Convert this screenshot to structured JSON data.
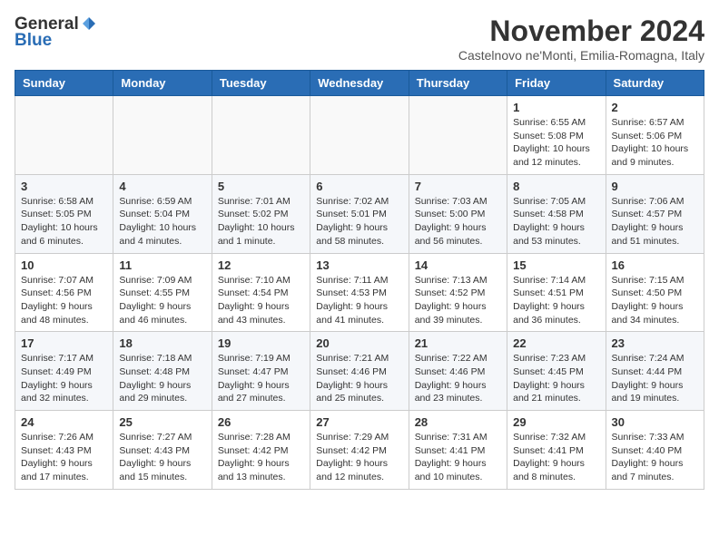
{
  "header": {
    "logo_general": "General",
    "logo_blue": "Blue",
    "month_title": "November 2024",
    "subtitle": "Castelnovo ne'Monti, Emilia-Romagna, Italy"
  },
  "weekdays": [
    "Sunday",
    "Monday",
    "Tuesday",
    "Wednesday",
    "Thursday",
    "Friday",
    "Saturday"
  ],
  "weeks": [
    [
      {
        "day": "",
        "info": ""
      },
      {
        "day": "",
        "info": ""
      },
      {
        "day": "",
        "info": ""
      },
      {
        "day": "",
        "info": ""
      },
      {
        "day": "",
        "info": ""
      },
      {
        "day": "1",
        "info": "Sunrise: 6:55 AM\nSunset: 5:08 PM\nDaylight: 10 hours and 12 minutes."
      },
      {
        "day": "2",
        "info": "Sunrise: 6:57 AM\nSunset: 5:06 PM\nDaylight: 10 hours and 9 minutes."
      }
    ],
    [
      {
        "day": "3",
        "info": "Sunrise: 6:58 AM\nSunset: 5:05 PM\nDaylight: 10 hours and 6 minutes."
      },
      {
        "day": "4",
        "info": "Sunrise: 6:59 AM\nSunset: 5:04 PM\nDaylight: 10 hours and 4 minutes."
      },
      {
        "day": "5",
        "info": "Sunrise: 7:01 AM\nSunset: 5:02 PM\nDaylight: 10 hours and 1 minute."
      },
      {
        "day": "6",
        "info": "Sunrise: 7:02 AM\nSunset: 5:01 PM\nDaylight: 9 hours and 58 minutes."
      },
      {
        "day": "7",
        "info": "Sunrise: 7:03 AM\nSunset: 5:00 PM\nDaylight: 9 hours and 56 minutes."
      },
      {
        "day": "8",
        "info": "Sunrise: 7:05 AM\nSunset: 4:58 PM\nDaylight: 9 hours and 53 minutes."
      },
      {
        "day": "9",
        "info": "Sunrise: 7:06 AM\nSunset: 4:57 PM\nDaylight: 9 hours and 51 minutes."
      }
    ],
    [
      {
        "day": "10",
        "info": "Sunrise: 7:07 AM\nSunset: 4:56 PM\nDaylight: 9 hours and 48 minutes."
      },
      {
        "day": "11",
        "info": "Sunrise: 7:09 AM\nSunset: 4:55 PM\nDaylight: 9 hours and 46 minutes."
      },
      {
        "day": "12",
        "info": "Sunrise: 7:10 AM\nSunset: 4:54 PM\nDaylight: 9 hours and 43 minutes."
      },
      {
        "day": "13",
        "info": "Sunrise: 7:11 AM\nSunset: 4:53 PM\nDaylight: 9 hours and 41 minutes."
      },
      {
        "day": "14",
        "info": "Sunrise: 7:13 AM\nSunset: 4:52 PM\nDaylight: 9 hours and 39 minutes."
      },
      {
        "day": "15",
        "info": "Sunrise: 7:14 AM\nSunset: 4:51 PM\nDaylight: 9 hours and 36 minutes."
      },
      {
        "day": "16",
        "info": "Sunrise: 7:15 AM\nSunset: 4:50 PM\nDaylight: 9 hours and 34 minutes."
      }
    ],
    [
      {
        "day": "17",
        "info": "Sunrise: 7:17 AM\nSunset: 4:49 PM\nDaylight: 9 hours and 32 minutes."
      },
      {
        "day": "18",
        "info": "Sunrise: 7:18 AM\nSunset: 4:48 PM\nDaylight: 9 hours and 29 minutes."
      },
      {
        "day": "19",
        "info": "Sunrise: 7:19 AM\nSunset: 4:47 PM\nDaylight: 9 hours and 27 minutes."
      },
      {
        "day": "20",
        "info": "Sunrise: 7:21 AM\nSunset: 4:46 PM\nDaylight: 9 hours and 25 minutes."
      },
      {
        "day": "21",
        "info": "Sunrise: 7:22 AM\nSunset: 4:46 PM\nDaylight: 9 hours and 23 minutes."
      },
      {
        "day": "22",
        "info": "Sunrise: 7:23 AM\nSunset: 4:45 PM\nDaylight: 9 hours and 21 minutes."
      },
      {
        "day": "23",
        "info": "Sunrise: 7:24 AM\nSunset: 4:44 PM\nDaylight: 9 hours and 19 minutes."
      }
    ],
    [
      {
        "day": "24",
        "info": "Sunrise: 7:26 AM\nSunset: 4:43 PM\nDaylight: 9 hours and 17 minutes."
      },
      {
        "day": "25",
        "info": "Sunrise: 7:27 AM\nSunset: 4:43 PM\nDaylight: 9 hours and 15 minutes."
      },
      {
        "day": "26",
        "info": "Sunrise: 7:28 AM\nSunset: 4:42 PM\nDaylight: 9 hours and 13 minutes."
      },
      {
        "day": "27",
        "info": "Sunrise: 7:29 AM\nSunset: 4:42 PM\nDaylight: 9 hours and 12 minutes."
      },
      {
        "day": "28",
        "info": "Sunrise: 7:31 AM\nSunset: 4:41 PM\nDaylight: 9 hours and 10 minutes."
      },
      {
        "day": "29",
        "info": "Sunrise: 7:32 AM\nSunset: 4:41 PM\nDaylight: 9 hours and 8 minutes."
      },
      {
        "day": "30",
        "info": "Sunrise: 7:33 AM\nSunset: 4:40 PM\nDaylight: 9 hours and 7 minutes."
      }
    ]
  ]
}
